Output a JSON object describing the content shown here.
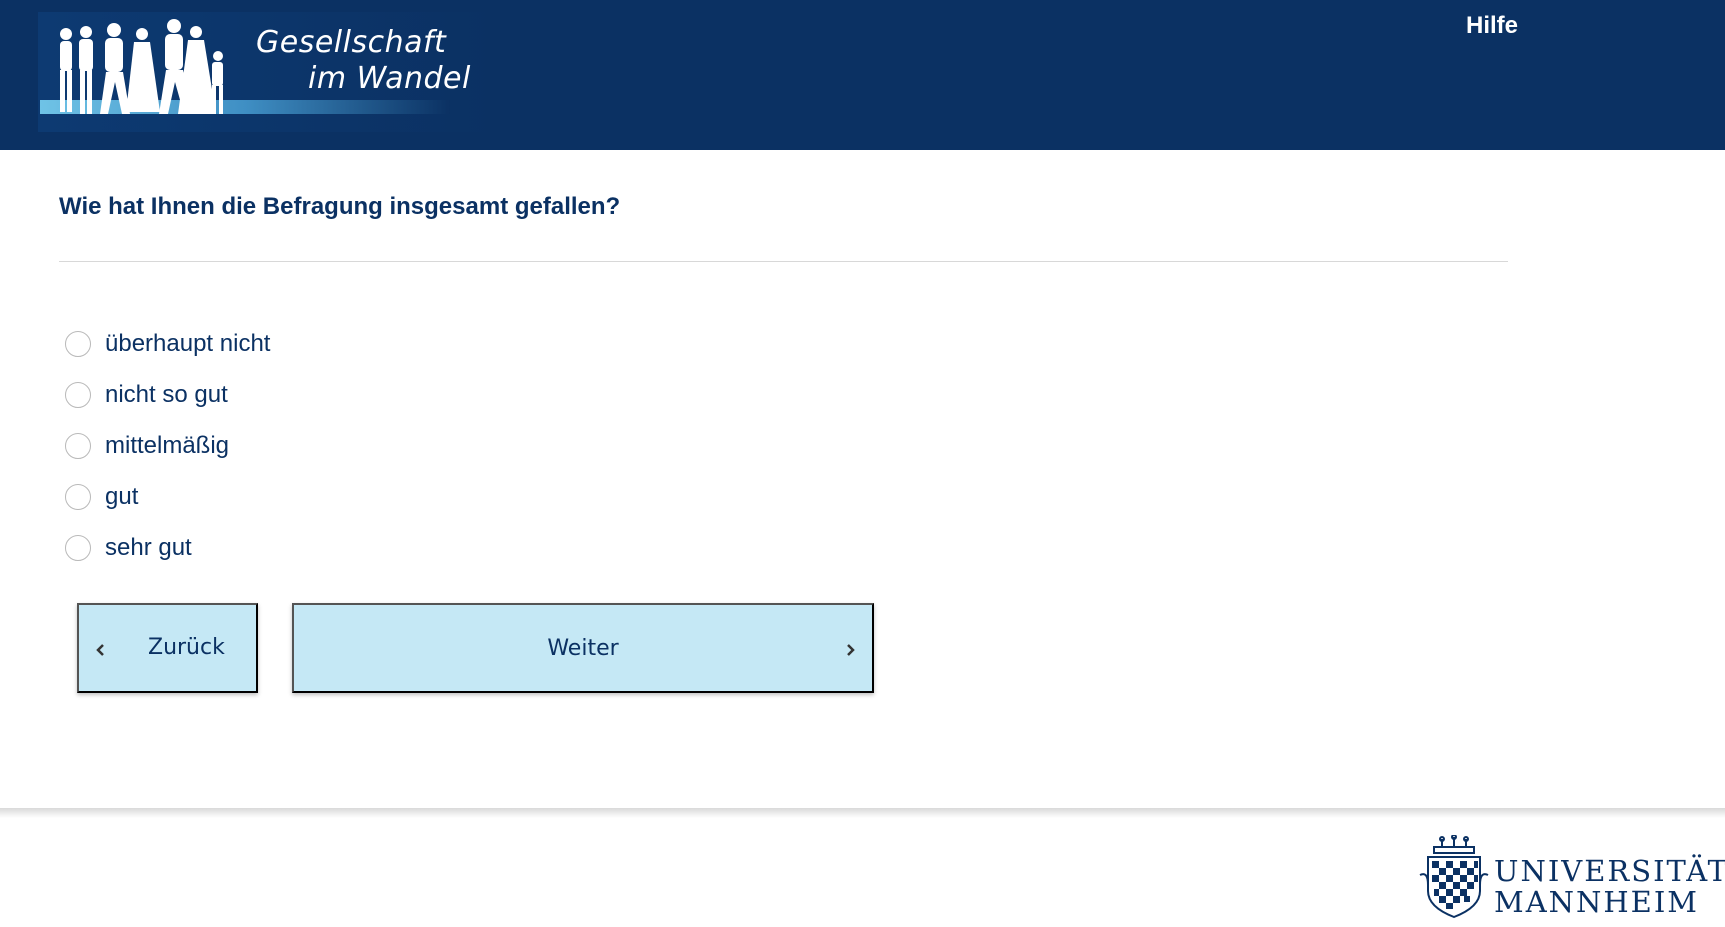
{
  "header": {
    "logo_line1": "Gesellschaft",
    "logo_line2": "im Wandel",
    "help_label": "Hilfe"
  },
  "question": {
    "text": "Wie hat Ihnen die Befragung insgesamt gefallen?",
    "options": [
      {
        "label": "überhaupt nicht",
        "selected": false
      },
      {
        "label": "nicht so gut",
        "selected": false
      },
      {
        "label": "mittelmäßig",
        "selected": false
      },
      {
        "label": "gut",
        "selected": false
      },
      {
        "label": "sehr gut",
        "selected": false
      }
    ]
  },
  "navigation": {
    "back_label": "Zurück",
    "next_label": "Weiter"
  },
  "footer": {
    "university_line1": "UNIVERSITÄT",
    "university_line2": "MANNHEIM"
  },
  "colors": {
    "brand_navy": "#0b3163",
    "button_bg": "#c5e8f5"
  },
  "icons": [
    "people-silhouette-logo",
    "chevron-left-icon",
    "chevron-right-icon",
    "university-crest-icon"
  ]
}
